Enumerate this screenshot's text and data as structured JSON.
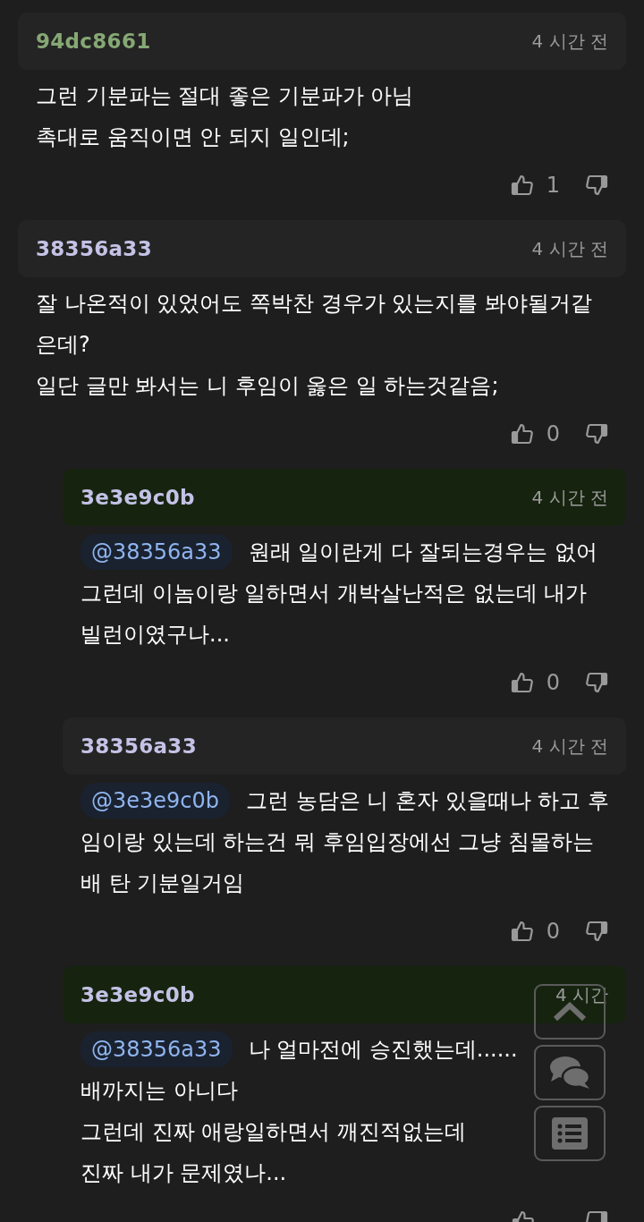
{
  "comments": [
    {
      "author": "94dc8661",
      "color": "#86a874",
      "time": "4 시간 전",
      "highlighted": false,
      "lines": [
        "그런 기분파는 절대 좋은 기분파가 아님",
        "촉대로 움직이면 안 되지 일인데;"
      ],
      "likes": "1"
    },
    {
      "author": "38356a33",
      "color": "#c4c2e6",
      "time": "4 시간 전",
      "highlighted": false,
      "lines": [
        "잘 나온적이 있었어도 쪽박찬 경우가 있는지를 봐야될거같",
        "은데?",
        "일단 글만 봐서는 니 후임이 옳은 일 하는것같음;"
      ],
      "likes": "0",
      "children": [
        {
          "author": "3e3e9c0b",
          "color": "#c4c2e6",
          "time": "4 시간 전",
          "highlighted": true,
          "mention": "@38356a33",
          "lines": [
            "원래 일이란게 다 잘되는경우는 없어",
            "그런데 이놈이랑 일하면서 개박살난적은 없는데 내가",
            "빌런이였구나..."
          ],
          "likes": "0"
        },
        {
          "author": "38356a33",
          "color": "#c4c2e6",
          "time": "4 시간 전",
          "highlighted": false,
          "mention": "@3e3e9c0b",
          "lines": [
            "그런 농담은 니 혼자 있을때나 하고 후",
            "임이랑 있는데 하는건 뭐 후임입장에선 그냥 침몰하는",
            "배 탄 기분일거임"
          ],
          "likes": "0"
        },
        {
          "author": "3e3e9c0b",
          "color": "#c4c2e6",
          "time": "4 시간",
          "highlighted": true,
          "mention": "@38356a33",
          "lines": [
            "나 얼마전에 승진했는데......",
            "배까지는 아니다",
            "그런데 진짜 애랑일하면서 깨진적없는데",
            "진짜 내가 문제였나..."
          ]
        }
      ]
    }
  ]
}
